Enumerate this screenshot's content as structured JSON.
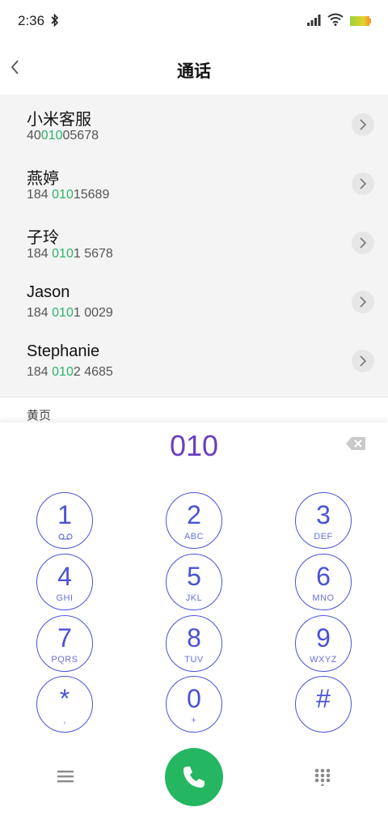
{
  "status_bar": {
    "time": "2:36",
    "icons": [
      "bluetooth-icon",
      "signal-icon",
      "wifi-icon",
      "battery-icon"
    ]
  },
  "header": {
    "title": "通话",
    "back_icon": "back-icon"
  },
  "contacts": [
    {
      "name": "小米客服",
      "number_pre": "40",
      "number_hl": "010",
      "number_post": "05678"
    },
    {
      "name": "燕婷",
      "number_pre": "184 ",
      "number_hl": "010",
      "number_post": "15689"
    },
    {
      "name": "子玲",
      "number_pre": "184 ",
      "number_hl": "010",
      "number_post": "1 5678"
    },
    {
      "name": "Jason",
      "number_pre": "184 ",
      "number_hl": "010",
      "number_post": "1 0029"
    },
    {
      "name": "Stephanie",
      "number_pre": "184 ",
      "number_hl": "010",
      "number_post": "2 4685"
    }
  ],
  "section": {
    "yellow_pages": "黄页"
  },
  "dialer": {
    "display": "010",
    "keys": [
      {
        "digit": "1",
        "letters": ""
      },
      {
        "digit": "2",
        "letters": "ABC"
      },
      {
        "digit": "3",
        "letters": "DEF"
      },
      {
        "digit": "4",
        "letters": "GHI"
      },
      {
        "digit": "5",
        "letters": "JKL"
      },
      {
        "digit": "6",
        "letters": "MNO"
      },
      {
        "digit": "7",
        "letters": "PQRS"
      },
      {
        "digit": "8",
        "letters": "TUV"
      },
      {
        "digit": "9",
        "letters": "WXYZ"
      },
      {
        "digit": "*",
        "letters": ","
      },
      {
        "digit": "0",
        "letters": "+"
      },
      {
        "digit": "#",
        "letters": ""
      }
    ]
  },
  "colors": {
    "accent": "#4a52d6",
    "display": "#6a3fc0",
    "highlight": "#2db36a",
    "call": "#25b662"
  }
}
